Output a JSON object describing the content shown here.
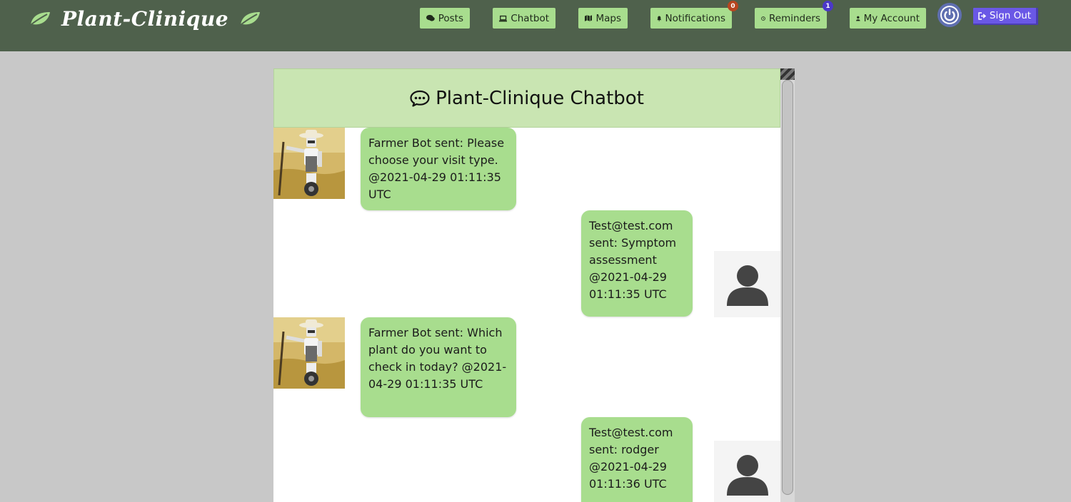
{
  "brand": {
    "title": "Plant-Clinique"
  },
  "nav": {
    "posts": "Posts",
    "chatbot": "Chatbot",
    "maps": "Maps",
    "notifications": "Notifications",
    "notifications_count": "0",
    "reminders": "Reminders",
    "reminders_count": "1",
    "account": "My Account",
    "signout": "Sign Out"
  },
  "chat": {
    "title": "Plant-Clinique Chatbot",
    "messages": [
      {
        "sender": "bot",
        "text": "Farmer Bot sent: Please choose your visit type. @2021-04-29 01:11:35 UTC"
      },
      {
        "sender": "user",
        "text": "Test@test.com sent: Symptom assessment @2021-04-29 01:11:35 UTC"
      },
      {
        "sender": "bot",
        "text": "Farmer Bot sent: Which plant do you want to check in today? @2021-04-29 01:11:35 UTC"
      },
      {
        "sender": "user",
        "text": "Test@test.com sent: rodger @2021-04-29 01:11:36 UTC"
      }
    ]
  },
  "colors": {
    "navbar": "#4f614c",
    "nav_button": "#a8dd8e",
    "bubble": "#a8dd8e",
    "header": "#c9e5b2",
    "signout": "#6a58e6",
    "page": "#c8c8c8"
  },
  "icons": [
    "leaf-icon",
    "comments-icon",
    "laptop-icon",
    "map-icon",
    "bell-icon",
    "clock-icon",
    "user-icon",
    "power-icon",
    "sign-out-icon",
    "chat-bubble-icon",
    "robot-farmer-avatar",
    "user-avatar-icon"
  ]
}
